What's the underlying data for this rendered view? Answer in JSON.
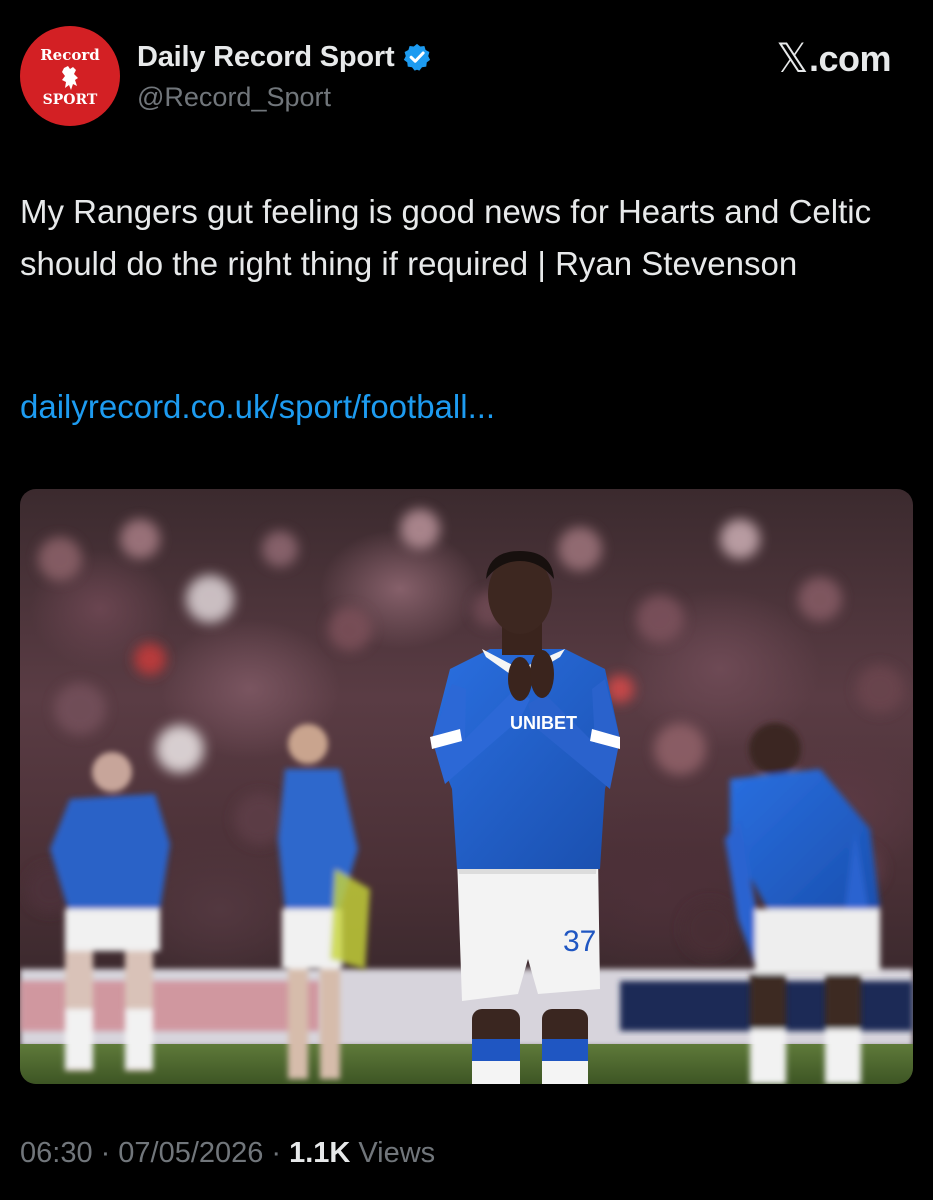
{
  "account": {
    "avatar_text_top": "Record",
    "avatar_text_bottom": "SPORT",
    "display_name": "Daily Record Sport",
    "handle": "@Record_Sport",
    "verified": true
  },
  "brand": {
    "logo_symbol": "𝕏",
    "logo_suffix": ".com"
  },
  "tweet": {
    "text": "My Rangers gut feeling is good news for Hearts and Celtic should do the right thing if required | Ryan Stevenson",
    "link": "dailyrecord.co.uk/sport/football..."
  },
  "media": {
    "type": "photo",
    "player_number": "37",
    "sponsor": "UNIBET"
  },
  "meta": {
    "time": "06:30",
    "separator": "·",
    "date": "07/05/2026",
    "views_count": "1.1K",
    "views_label": "Views"
  },
  "colors": {
    "background": "#000000",
    "text": "#e7e9ea",
    "secondary": "#71767b",
    "link": "#1d9bf0",
    "verified": "#1d9bf0",
    "avatar": "#d32024",
    "kit": "#1f5fc9"
  },
  "icons": [
    "verified-badge-icon",
    "x-logo-icon"
  ]
}
